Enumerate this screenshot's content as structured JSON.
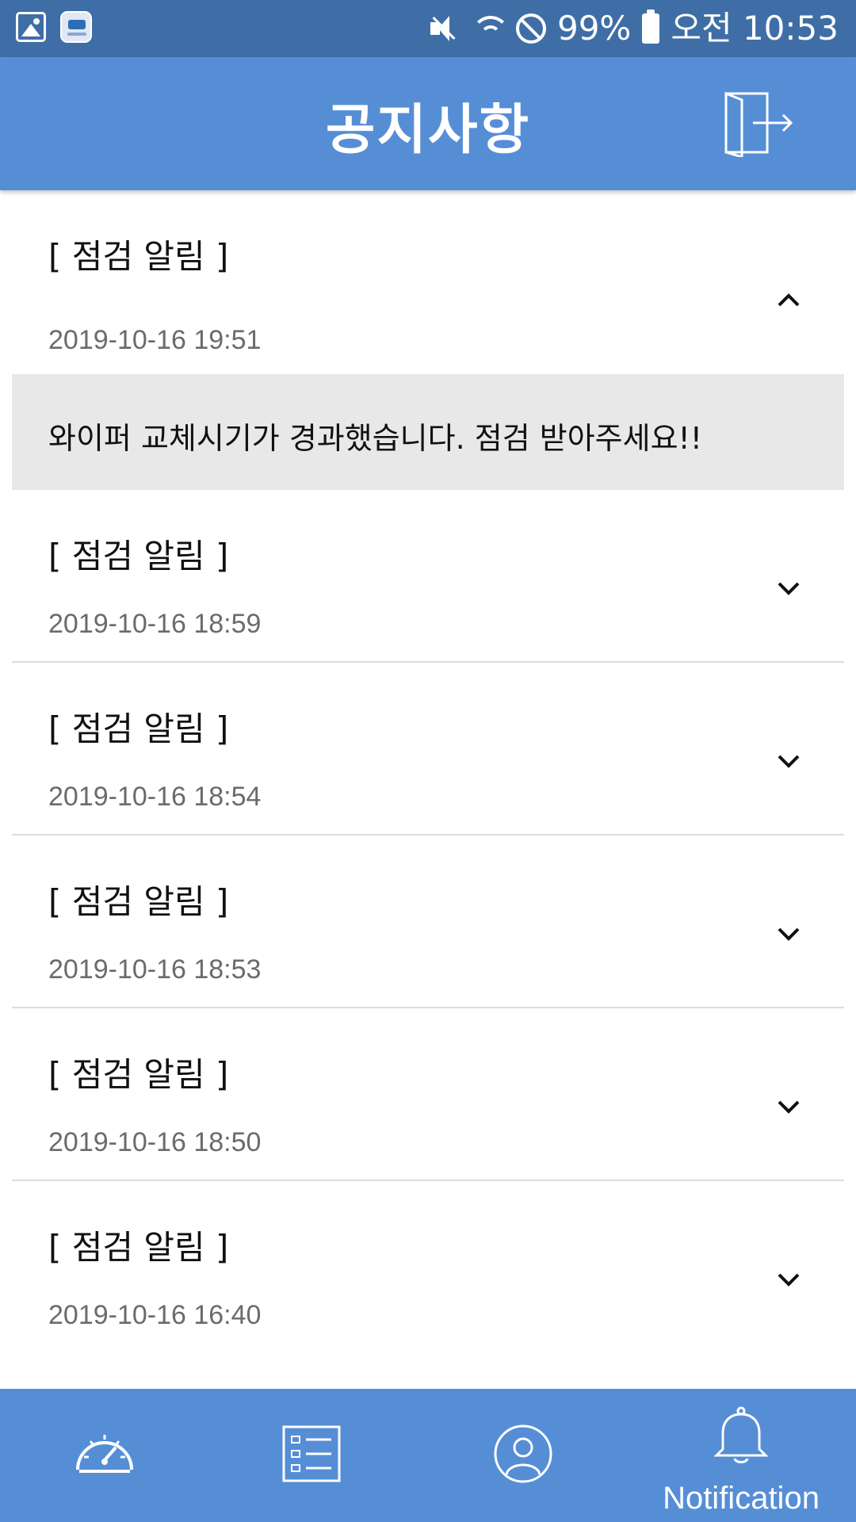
{
  "status_bar": {
    "battery": "99%",
    "time": "오전 10:53",
    "icons": [
      "gallery-icon",
      "app-icon",
      "mute-icon",
      "wifi-icon",
      "do-not-disturb-icon",
      "battery-icon"
    ]
  },
  "header": {
    "title": "공지사항",
    "logout_icon": "logout-icon"
  },
  "notices": [
    {
      "title": "[ 점검 알림 ]",
      "date": "2019-10-16 19:51",
      "expanded": true,
      "detail": "와이퍼 교체시기가 경과했습니다. 점검 받아주세요!!"
    },
    {
      "title": "[ 점검 알림 ]",
      "date": "2019-10-16 18:59",
      "expanded": false
    },
    {
      "title": "[ 점검 알림 ]",
      "date": "2019-10-16 18:54",
      "expanded": false
    },
    {
      "title": "[ 점검 알림 ]",
      "date": "2019-10-16 18:53",
      "expanded": false
    },
    {
      "title": "[ 점검 알림 ]",
      "date": "2019-10-16 18:50",
      "expanded": false
    },
    {
      "title": "[ 점검 알림 ]",
      "date": "2019-10-16 16:40",
      "expanded": false
    }
  ],
  "bottom_nav": {
    "items": [
      {
        "icon": "speedometer-icon",
        "label": ""
      },
      {
        "icon": "list-icon",
        "label": ""
      },
      {
        "icon": "profile-icon",
        "label": ""
      },
      {
        "icon": "bell-icon",
        "label": "Notification",
        "active": true
      }
    ]
  },
  "colors": {
    "status_bar": "#3f6ea6",
    "primary": "#568ed6",
    "detail_bg": "#e8e8e8",
    "date_text": "#6b6b6b"
  }
}
